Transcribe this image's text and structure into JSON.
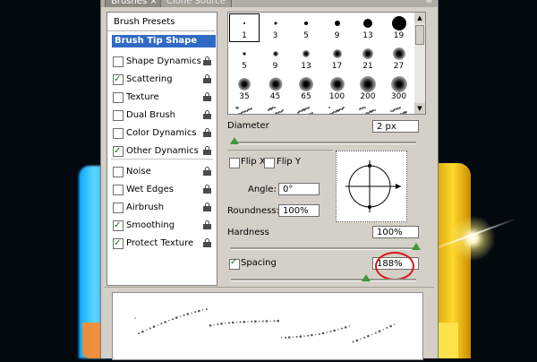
{
  "window": {
    "tabs": [
      {
        "label": "Brushes ×"
      },
      {
        "label": "Clone Source"
      }
    ]
  },
  "sidebar": {
    "presets_label": "Brush Presets",
    "selected_label": "Brush Tip Shape",
    "options": [
      {
        "label": "Shape Dynamics",
        "checked": false,
        "lock": true
      },
      {
        "label": "Scattering",
        "checked": true,
        "lock": true
      },
      {
        "label": "Texture",
        "checked": false,
        "lock": true
      },
      {
        "label": "Dual Brush",
        "checked": false,
        "lock": true
      },
      {
        "label": "Color Dynamics",
        "checked": false,
        "lock": true
      },
      {
        "label": "Other Dynamics",
        "checked": true,
        "lock": true
      },
      {
        "label": "Noise",
        "checked": false,
        "lock": true
      },
      {
        "label": "Wet Edges",
        "checked": false,
        "lock": true
      },
      {
        "label": "Airbrush",
        "checked": false,
        "lock": true
      },
      {
        "label": "Smoothing",
        "checked": true,
        "lock": true
      },
      {
        "label": "Protect Texture",
        "checked": true,
        "lock": true
      }
    ]
  },
  "brush_tips": [
    {
      "size": "1",
      "dot": 2,
      "soft": false
    },
    {
      "size": "3",
      "dot": 3,
      "soft": false
    },
    {
      "size": "5",
      "dot": 4,
      "soft": false
    },
    {
      "size": "9",
      "dot": 6,
      "soft": false
    },
    {
      "size": "13",
      "dot": 10,
      "soft": false
    },
    {
      "size": "19",
      "dot": 16,
      "soft": false
    },
    {
      "size": "5",
      "dot": 4,
      "soft": true
    },
    {
      "size": "9",
      "dot": 6,
      "soft": true
    },
    {
      "size": "13",
      "dot": 8,
      "soft": true
    },
    {
      "size": "17",
      "dot": 10,
      "soft": true
    },
    {
      "size": "21",
      "dot": 12,
      "soft": true
    },
    {
      "size": "27",
      "dot": 14,
      "soft": true
    },
    {
      "size": "35",
      "dot": 14,
      "soft": true
    },
    {
      "size": "45",
      "dot": 15,
      "soft": true
    },
    {
      "size": "65",
      "dot": 16,
      "soft": true
    },
    {
      "size": "100",
      "dot": 16,
      "soft": true
    },
    {
      "size": "200",
      "dot": 18,
      "soft": true
    },
    {
      "size": "300",
      "dot": 18,
      "soft": true
    }
  ],
  "settings": {
    "diameter_label": "Diameter",
    "diameter_value": "2 px",
    "diameter_slider": 0.02,
    "flip_x_label": "Flip X",
    "flip_y_label": "Flip Y",
    "angle_label": "Angle:",
    "angle_value": "0°",
    "roundness_label": "Roundness:",
    "roundness_value": "100%",
    "hardness_label": "Hardness",
    "hardness_value": "100%",
    "hardness_slider": 1.0,
    "spacing_label": "Spacing",
    "spacing_checked": true,
    "spacing_value": "188%",
    "spacing_slider": 0.73
  },
  "colors": {
    "selection": "#316ac5",
    "highlight_circle": "#d8171c",
    "slider_thumb": "#3a9a3a"
  }
}
